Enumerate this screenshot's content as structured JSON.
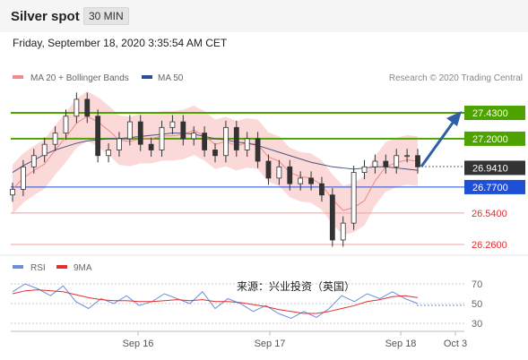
{
  "header": {
    "title": "Silver spot",
    "interval": "30 MIN"
  },
  "timestamp": "Friday, September 18, 2020 3:35:54 AM CET",
  "legend": {
    "bollinger": "MA 20 + Bollinger Bands",
    "ma50": "MA 50",
    "credit": "Research © 2020 Trading Central",
    "rsi": "RSI",
    "rsi_ma": "9MA"
  },
  "watermark": "来源：兴业投资（英国）",
  "colors": {
    "green": "#4fa300",
    "blue": "#1f4fd6",
    "red": "#e03030",
    "band": "#f9cccc",
    "ma50": "#47547d",
    "rsi": "#6b8fd9",
    "current_badge": "#333333",
    "arrow": "#2e5ea8"
  },
  "chart_data": [
    {
      "type": "line",
      "title": "Silver spot",
      "timeframe": "30 MIN",
      "x_ticks": [
        "Sep 16",
        "Sep 17",
        "Sep 18",
        "Oct 3"
      ],
      "levels": [
        {
          "value": 27.43,
          "label": "27.4300",
          "kind": "resistance",
          "color": "#4fa300"
        },
        {
          "value": 27.2,
          "label": "27.2000",
          "kind": "resistance",
          "color": "#4fa300"
        },
        {
          "value": 26.941,
          "label": "26.9410",
          "kind": "current",
          "color": "#333333"
        },
        {
          "value": 26.77,
          "label": "26.7700",
          "kind": "pivot",
          "color": "#1f4fd6"
        },
        {
          "value": 26.54,
          "label": "26.5400",
          "kind": "support",
          "color": "#e03030"
        },
        {
          "value": 26.26,
          "label": "26.2600",
          "kind": "support",
          "color": "#e03030"
        }
      ],
      "price_series": [
        26.75,
        26.95,
        27.05,
        27.15,
        27.25,
        27.4,
        27.55,
        27.4,
        27.05,
        27.1,
        27.2,
        27.35,
        27.15,
        27.1,
        27.3,
        27.35,
        27.2,
        27.25,
        27.1,
        27.05,
        27.3,
        27.1,
        27.2,
        27.0,
        26.85,
        26.95,
        26.8,
        26.85,
        26.8,
        26.7,
        26.3,
        26.45,
        26.9,
        26.95,
        27.0,
        26.95,
        27.05,
        27.05,
        26.95
      ],
      "ma50_series": [
        26.9,
        26.96,
        27.01,
        27.06,
        27.1,
        27.13,
        27.16,
        27.18,
        27.19,
        27.2,
        27.2,
        27.21,
        27.22,
        27.23,
        27.24,
        27.25,
        27.25,
        27.24,
        27.22,
        27.2,
        27.19,
        27.17,
        27.16,
        27.14,
        27.11,
        27.08,
        27.05,
        27.02,
        26.99,
        26.97,
        26.95,
        26.94,
        26.93,
        26.94,
        26.95,
        26.95,
        26.94,
        26.93,
        26.92
      ],
      "projection": {
        "from": 26.941,
        "to": 27.43
      }
    },
    {
      "type": "line",
      "title": "RSI",
      "yticks": [
        70,
        50,
        30
      ],
      "ylim": [
        20,
        80
      ],
      "rsi_series": [
        62,
        70,
        65,
        58,
        68,
        52,
        45,
        55,
        50,
        58,
        48,
        52,
        60,
        55,
        50,
        62,
        45,
        55,
        50,
        42,
        48,
        40,
        35,
        42,
        36,
        45,
        58,
        52,
        60,
        55,
        62,
        55,
        50
      ],
      "ma_series": [
        60,
        63,
        64,
        63,
        62,
        59,
        56,
        54,
        53,
        53,
        52,
        52,
        53,
        54,
        53,
        54,
        52,
        52,
        51,
        49,
        47,
        44,
        42,
        40,
        40,
        42,
        45,
        48,
        52,
        54,
        57,
        58,
        56
      ]
    }
  ]
}
